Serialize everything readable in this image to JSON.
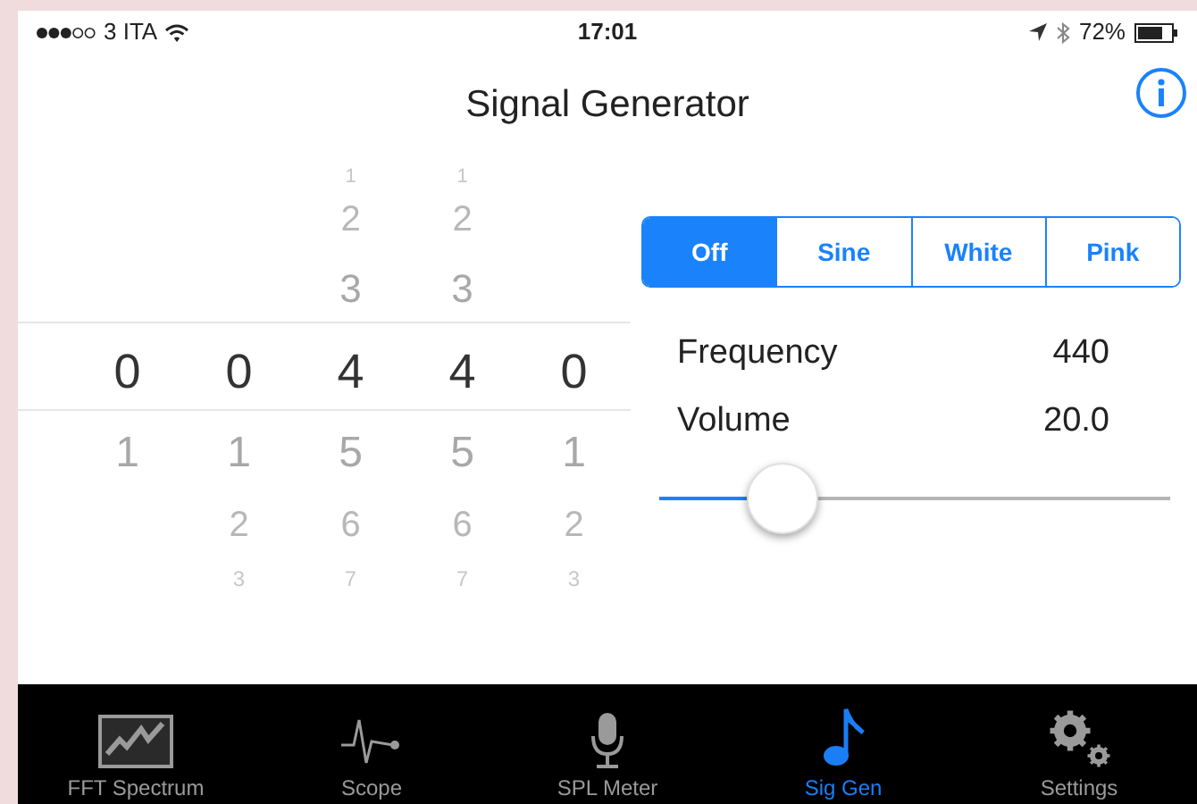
{
  "status_bar": {
    "carrier": "3 ITA",
    "time": "17:01",
    "battery": "72%"
  },
  "nav_bar": {
    "title": "Signal Generator"
  },
  "picker": {
    "columns": [
      {
        "selected": "0",
        "below": [
          "1"
        ]
      },
      {
        "selected": "0",
        "below": [
          "1",
          "2",
          "3"
        ]
      },
      {
        "above": [
          "1",
          "2",
          "3"
        ],
        "selected": "4",
        "below": [
          "5",
          "6",
          "7"
        ]
      },
      {
        "above": [
          "1",
          "2",
          "3"
        ],
        "selected": "4",
        "below": [
          "5",
          "6",
          "7"
        ]
      },
      {
        "selected": "0",
        "below": [
          "1",
          "2",
          "3"
        ]
      }
    ]
  },
  "waveforms": [
    {
      "label": "Off",
      "selected": true
    },
    {
      "label": "Sine",
      "selected": false
    },
    {
      "label": "White",
      "selected": false
    },
    {
      "label": "Pink",
      "selected": false
    }
  ],
  "parameters": [
    {
      "label": "Frequency",
      "value": "440"
    },
    {
      "label": "Volume",
      "value": "20.0"
    }
  ],
  "volume_slider": {
    "level": 0.24
  },
  "tabs": [
    {
      "kind": "spectrum",
      "label": "FFT Spectrum",
      "selected": false
    },
    {
      "kind": "scope",
      "label": "Scope",
      "selected": false
    },
    {
      "kind": "mic",
      "label": "SPL Meter",
      "selected": false
    },
    {
      "kind": "note",
      "label": "Sig Gen",
      "selected": true
    },
    {
      "kind": "gear",
      "label": "Settings",
      "selected": false
    }
  ]
}
